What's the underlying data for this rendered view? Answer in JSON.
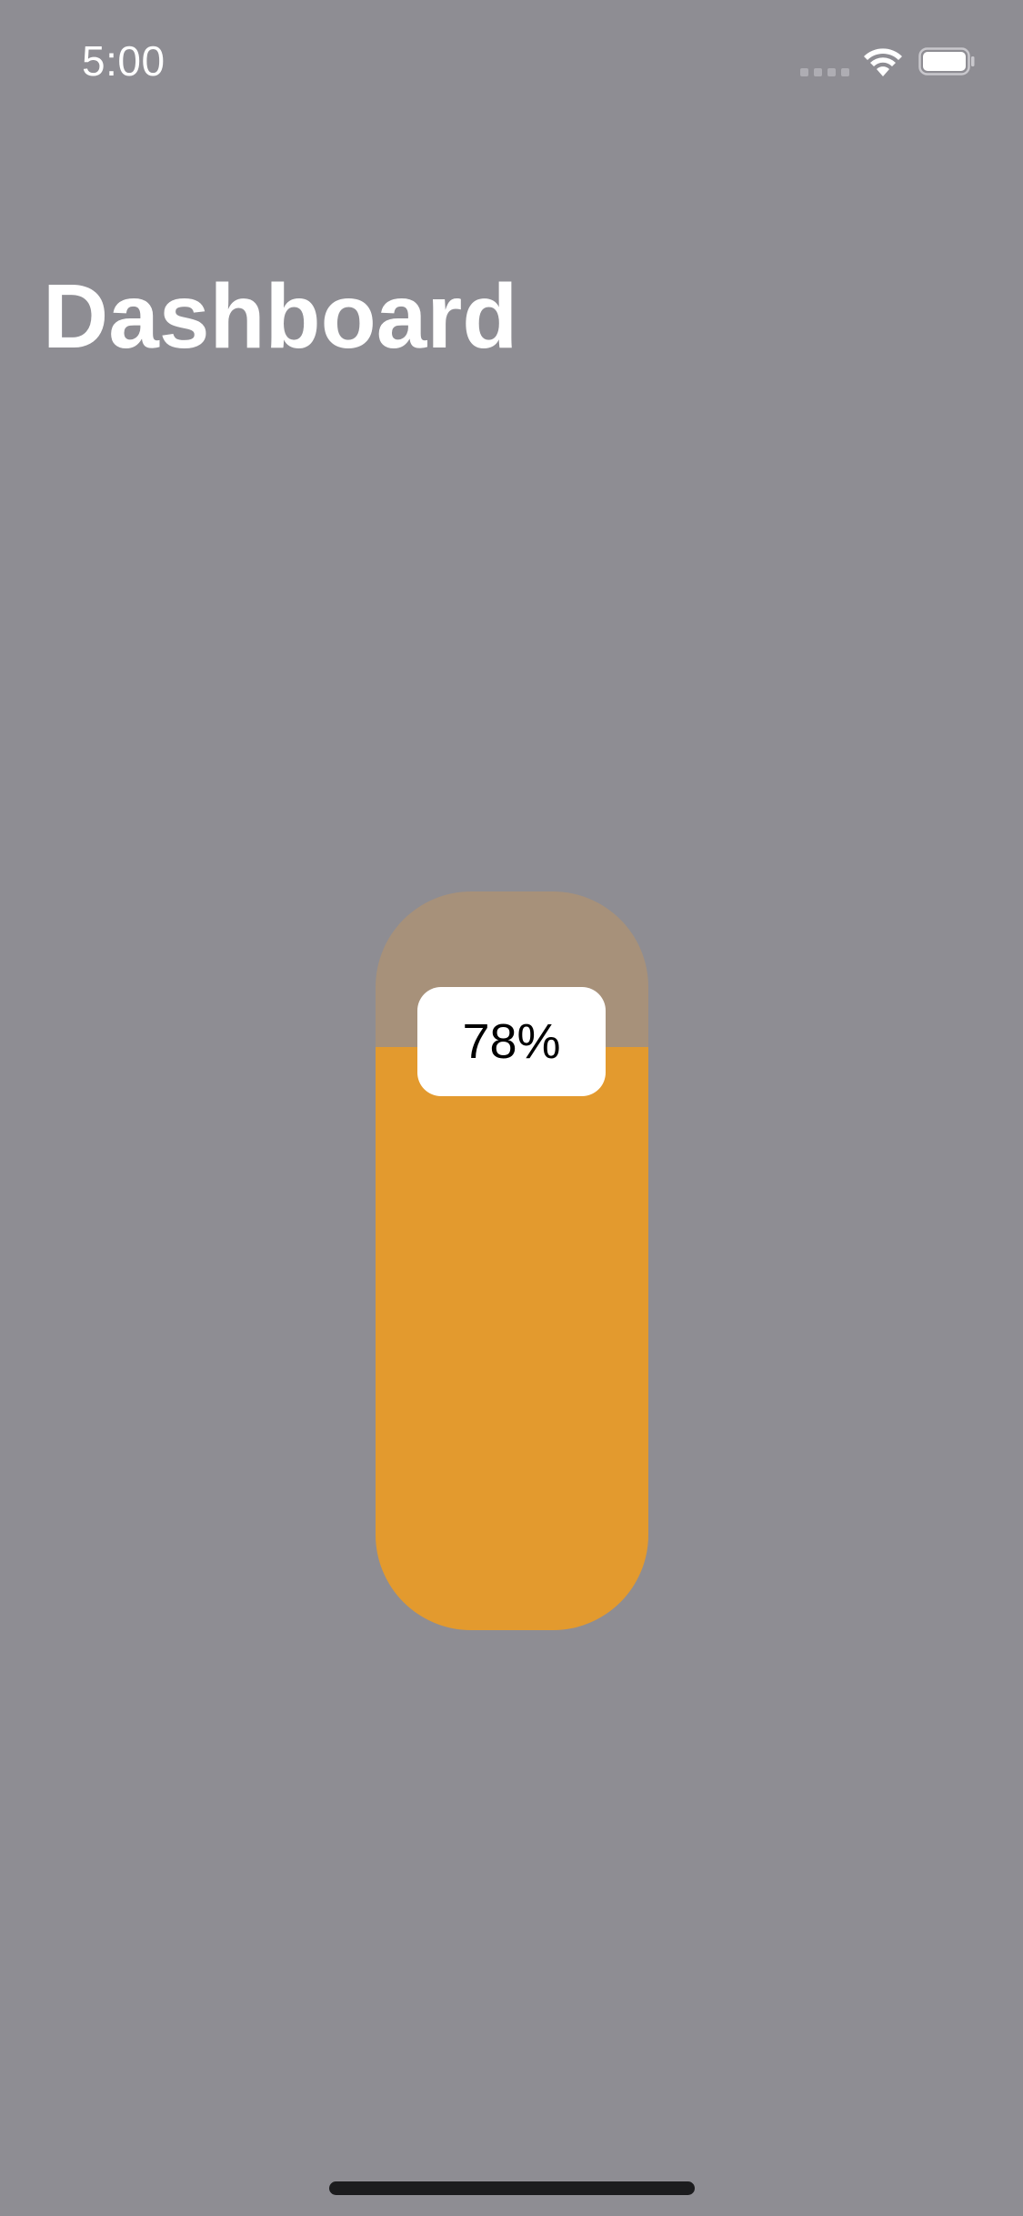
{
  "status_bar": {
    "time": "5:00",
    "icons": [
      "cellular-signal-icon",
      "wifi-icon",
      "battery-icon"
    ]
  },
  "header": {
    "title": "Dashboard"
  },
  "gauge": {
    "value_label": "78%",
    "fill_fraction": 0.79,
    "fill_color": "#e39a2e",
    "track_color": "#a7917a"
  },
  "colors": {
    "background": "#8e8d93",
    "text": "#ffffff"
  }
}
